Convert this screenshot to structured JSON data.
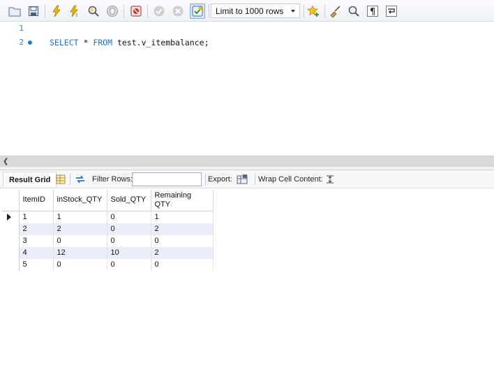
{
  "toolbar": {
    "limit_label": "Limit to 1000 rows",
    "buttons": [
      "open-folder",
      "save",
      "execute",
      "execute-current",
      "explain",
      "stop",
      "toggle-error-stop",
      "commit",
      "rollback",
      "autocommit"
    ]
  },
  "editor": {
    "line_numbers": [
      "1",
      "2"
    ],
    "code_keyword_1": "SELECT",
    "code_mid": " * ",
    "code_keyword_2": "FROM",
    "code_rest": " test.v_itembalance;"
  },
  "result_toolbar": {
    "result_grid_label": "Result Grid",
    "filter_rows_label": "Filter Rows:",
    "filter_value": "",
    "export_label": "Export:",
    "wrap_label": "Wrap Cell Content:"
  },
  "grid": {
    "columns": [
      "ItemID",
      "inStock_QTY",
      "Sold_QTY",
      "Remaining QTY"
    ],
    "rows": [
      [
        "1",
        "1",
        "0",
        "1"
      ],
      [
        "2",
        "2",
        "0",
        "2"
      ],
      [
        "3",
        "0",
        "0",
        "0"
      ],
      [
        "4",
        "12",
        "10",
        "2"
      ],
      [
        "5",
        "0",
        "0",
        "0"
      ]
    ]
  },
  "colors": {
    "keyword": "#1f6fd1",
    "alt_row": "#e9eef8",
    "gutter": "#3b7bbd"
  }
}
